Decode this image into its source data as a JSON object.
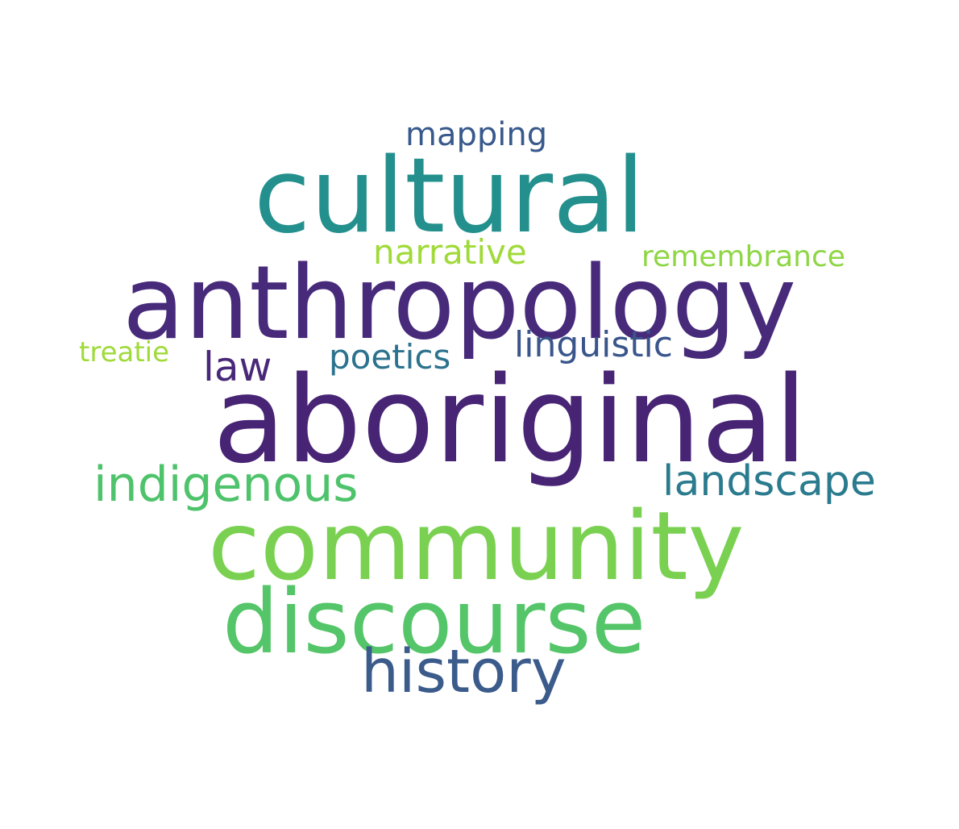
{
  "words": [
    {
      "key": "mapping",
      "text": "mapping",
      "color": "#38598c"
    },
    {
      "key": "cultural",
      "text": "cultural",
      "color": "#23908d"
    },
    {
      "key": "narrative",
      "text": "narrative",
      "color": "#a0da39"
    },
    {
      "key": "remembrance",
      "text": "remembrance",
      "color": "#8ed645"
    },
    {
      "key": "anthropology",
      "text": "anthropology",
      "color": "#472a7a"
    },
    {
      "key": "treatie",
      "text": "treatie",
      "color": "#a0da39"
    },
    {
      "key": "law",
      "text": "law",
      "color": "#482878"
    },
    {
      "key": "poetics",
      "text": "poetics",
      "color": "#2c728e"
    },
    {
      "key": "linguistic",
      "text": "linguistic",
      "color": "#39558c"
    },
    {
      "key": "aboriginal",
      "text": "aboriginal",
      "color": "#482475"
    },
    {
      "key": "indigenous",
      "text": "indigenous",
      "color": "#4ec36b"
    },
    {
      "key": "landscape",
      "text": "landscape",
      "color": "#2b7b8e"
    },
    {
      "key": "community",
      "text": "community",
      "color": "#7ad151"
    },
    {
      "key": "discourse",
      "text": "discourse",
      "color": "#54c568"
    },
    {
      "key": "history",
      "text": "history",
      "color": "#3b5b8b"
    }
  ]
}
